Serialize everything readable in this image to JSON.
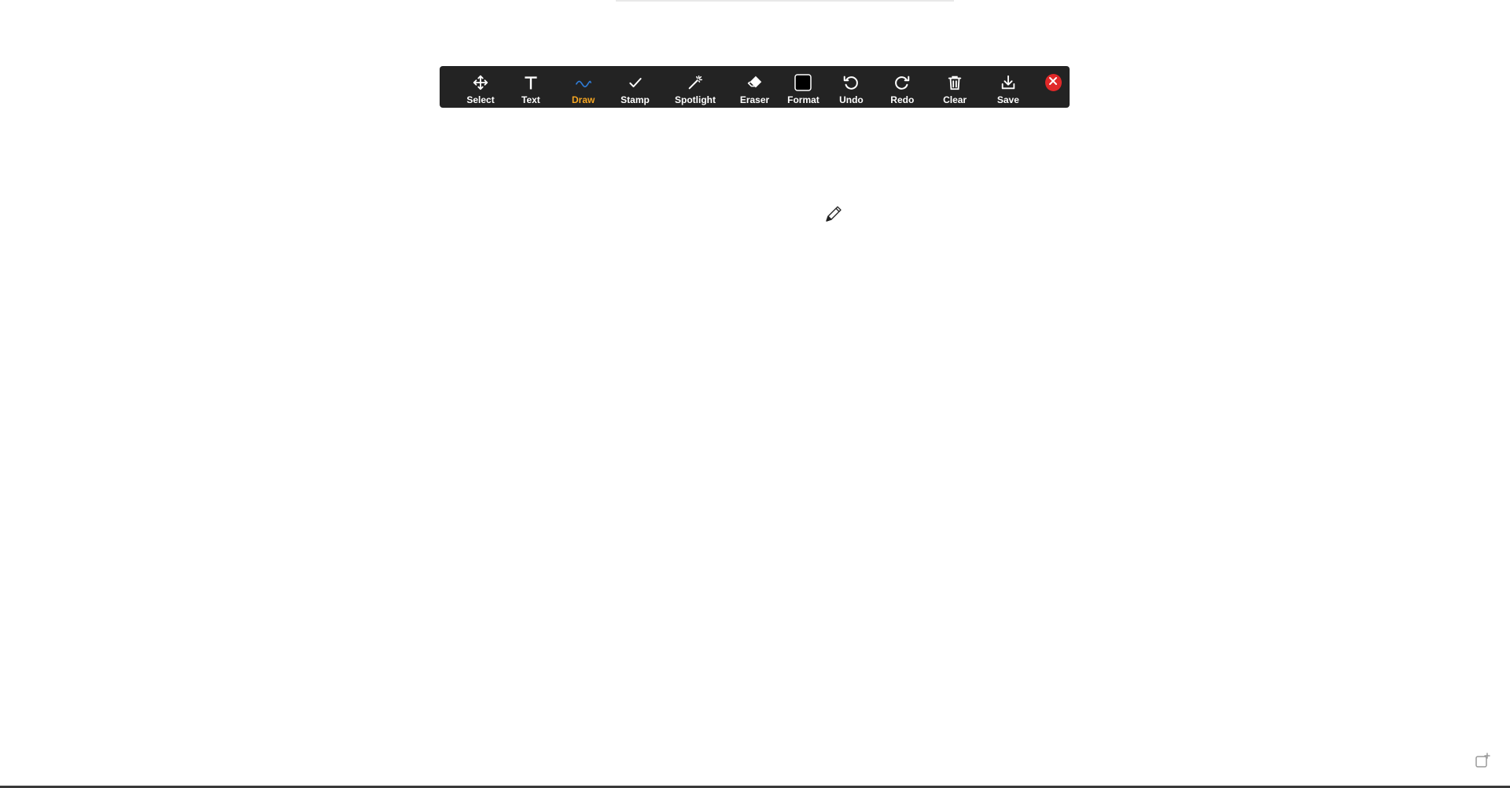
{
  "toolbar": {
    "tools": [
      {
        "label": "Select",
        "icon": "move-arrows-icon"
      },
      {
        "label": "Text",
        "icon": "text-t-icon"
      },
      {
        "label": "Draw",
        "icon": "squiggle-line-icon",
        "active": true
      },
      {
        "label": "Stamp",
        "icon": "checkmark-icon"
      },
      {
        "label": "Spotlight",
        "icon": "magic-wand-icon"
      },
      {
        "label": "Eraser",
        "icon": "eraser-icon"
      },
      {
        "label": "Format",
        "icon": "color-swatch-icon"
      },
      {
        "label": "Undo",
        "icon": "undo-arrow-icon"
      },
      {
        "label": "Redo",
        "icon": "redo-arrow-icon"
      },
      {
        "label": "Clear",
        "icon": "trash-icon"
      },
      {
        "label": "Save",
        "icon": "download-tray-icon"
      }
    ],
    "close_icon": "close-x-icon"
  },
  "colors": {
    "toolbar_bg": "#232323",
    "active_label": "#f5a623",
    "draw_line": "#2f7bd6",
    "format_swatch": "#000000",
    "close_bg": "#e02828"
  },
  "cursor": {
    "icon": "pencil-cursor-icon"
  },
  "corner": {
    "icon": "share-screen-corner-icon"
  }
}
